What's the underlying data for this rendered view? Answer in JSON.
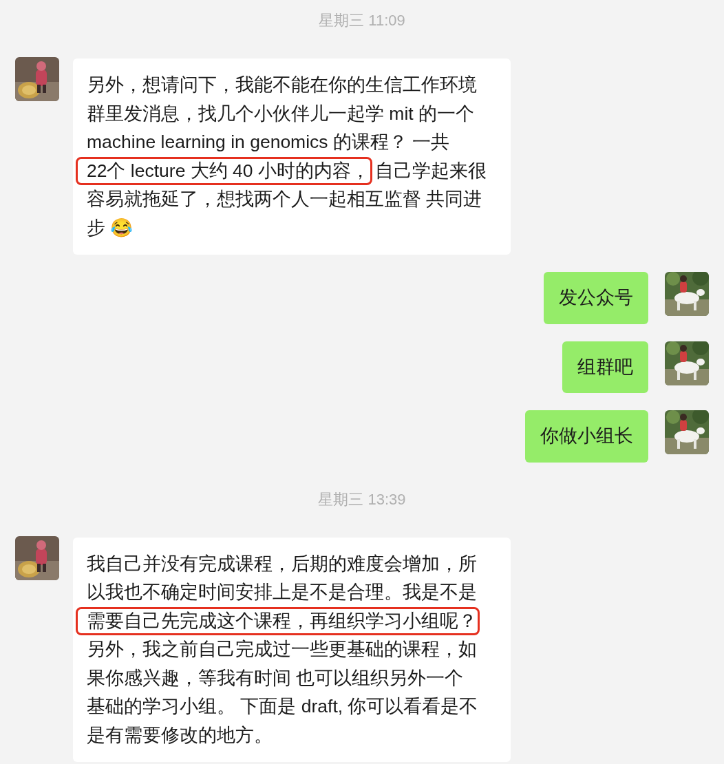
{
  "messages": [
    {
      "kind": "time",
      "text": "星期三 11:09"
    },
    {
      "kind": "incoming",
      "lines": [
        [
          {
            "text": "另外，想请问下，我能不能在你的生信工作环境",
            "highlighted": false
          }
        ],
        [
          {
            "text": "群里发消息，找几个小伙伴儿一起学 mit 的一个",
            "highlighted": false
          }
        ],
        [
          {
            "text": "machine learning in genomics 的课程？ 一共",
            "highlighted": false
          }
        ],
        [
          {
            "text": "22个 lecture 大约 40 小时的内容，",
            "highlighted": true
          },
          {
            "text": "自己学起来很",
            "highlighted": false
          }
        ],
        [
          {
            "text": "容易就拖延了，想找两个人一起相互监督 共同进",
            "highlighted": false
          }
        ],
        [
          {
            "text": "步 😂",
            "highlighted": false
          }
        ]
      ]
    },
    {
      "kind": "outgoing",
      "lines": [
        [
          {
            "text": "发公众号",
            "highlighted": false
          }
        ]
      ]
    },
    {
      "kind": "outgoing",
      "lines": [
        [
          {
            "text": "组群吧",
            "highlighted": false
          }
        ]
      ]
    },
    {
      "kind": "outgoing",
      "lines": [
        [
          {
            "text": "你做小组长",
            "highlighted": false
          }
        ]
      ]
    },
    {
      "kind": "time",
      "text": "星期三 13:39"
    },
    {
      "kind": "incoming",
      "lines": [
        [
          {
            "text": "我自己并没有完成课程，后期的难度会增加，所",
            "highlighted": false
          }
        ],
        [
          {
            "text": "以我也不确定时间安排上是不是合理。我是不是",
            "highlighted": false
          }
        ],
        [
          {
            "text": "需要自己先完成这个课程，再组织学习小组呢？",
            "highlighted": true
          }
        ],
        [
          {
            "text": "另外，我之前自己完成过一些更基础的课程，如",
            "highlighted": false
          }
        ],
        [
          {
            "text": "果你感兴趣，等我有时间 也可以组织另外一个",
            "highlighted": false
          }
        ],
        [
          {
            "text": "基础的学习小组。 下面是 draft, 你可以看看是不",
            "highlighted": false
          }
        ],
        [
          {
            "text": "是有需要修改的地方。",
            "highlighted": false
          }
        ]
      ]
    }
  ]
}
